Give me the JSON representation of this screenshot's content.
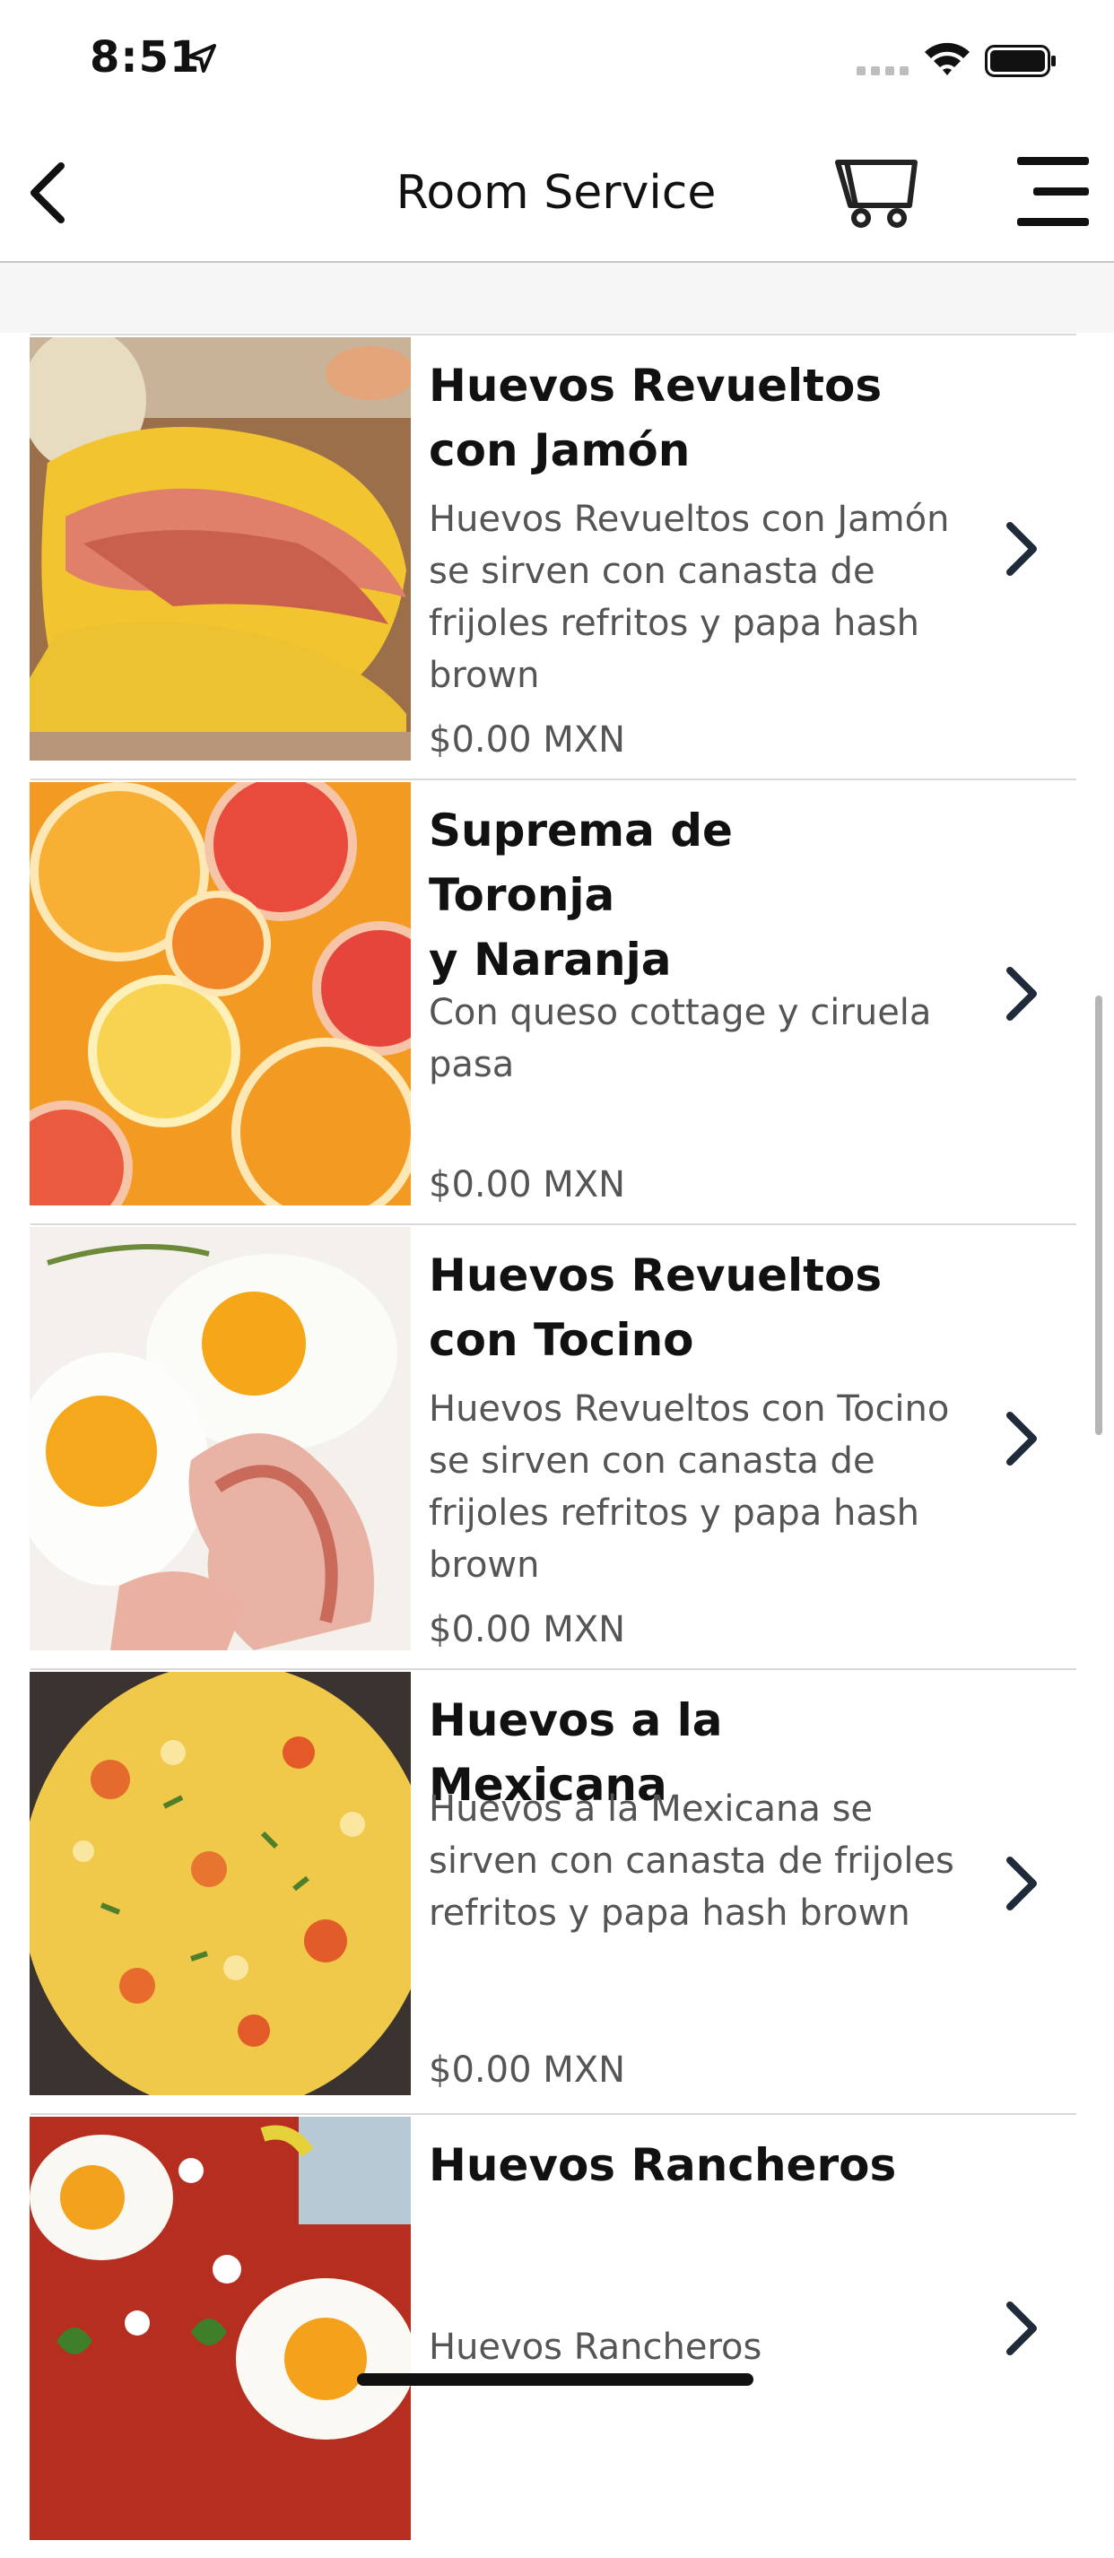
{
  "status_bar": {
    "time": "8:51"
  },
  "nav": {
    "title": "Room Service"
  },
  "items": [
    {
      "name": "Huevos Revueltos con Jamón",
      "name_line1": "Huevos Revueltos",
      "name_line2": "con Jamón",
      "description": "Huevos Revueltos con Jamón se sirven con canasta de frijoles refritos y papa hash brown",
      "price": "$0.00 MXN",
      "image": "scrambled-eggs-ham-photo"
    },
    {
      "name": "Suprema de Toronja y Naranja",
      "name_line1": "Suprema de Toronja",
      "name_line2": "y Naranja",
      "description": "Con queso cottage y ciruela pasa",
      "price": "$0.00 MXN",
      "image": "citrus-slices-photo"
    },
    {
      "name": "Huevos Revueltos con Tocino",
      "name_line1": "Huevos Revueltos",
      "name_line2": "con Tocino",
      "description": "Huevos Revueltos con Tocino se sirven con canasta de frijoles refritos y papa hash brown",
      "price": "$0.00 MXN",
      "image": "fried-eggs-bacon-photo"
    },
    {
      "name": "Huevos a la Mexicana",
      "name_line1": "Huevos a la Mexicana",
      "name_line2": "",
      "description": "Huevos a la Mexicana se sirven con canasta de frijoles refritos y papa hash brown",
      "price": "$0.00 MXN",
      "image": "mexican-scrambled-eggs-photo"
    },
    {
      "name": "Huevos Rancheros",
      "name_line1": "Huevos Rancheros",
      "name_line2": "",
      "description": "Huevos Rancheros",
      "price": "",
      "image": "huevos-rancheros-photo"
    }
  ],
  "icons": {
    "back": "chevron-left-icon",
    "cart": "shopping-cart-icon",
    "menu": "hamburger-menu-icon",
    "row_action": "chevron-right-icon"
  },
  "colors": {
    "text": "#111111",
    "secondary_text": "#555555",
    "divider": "#d9d9d9",
    "chevron": "#1f2a3a"
  }
}
